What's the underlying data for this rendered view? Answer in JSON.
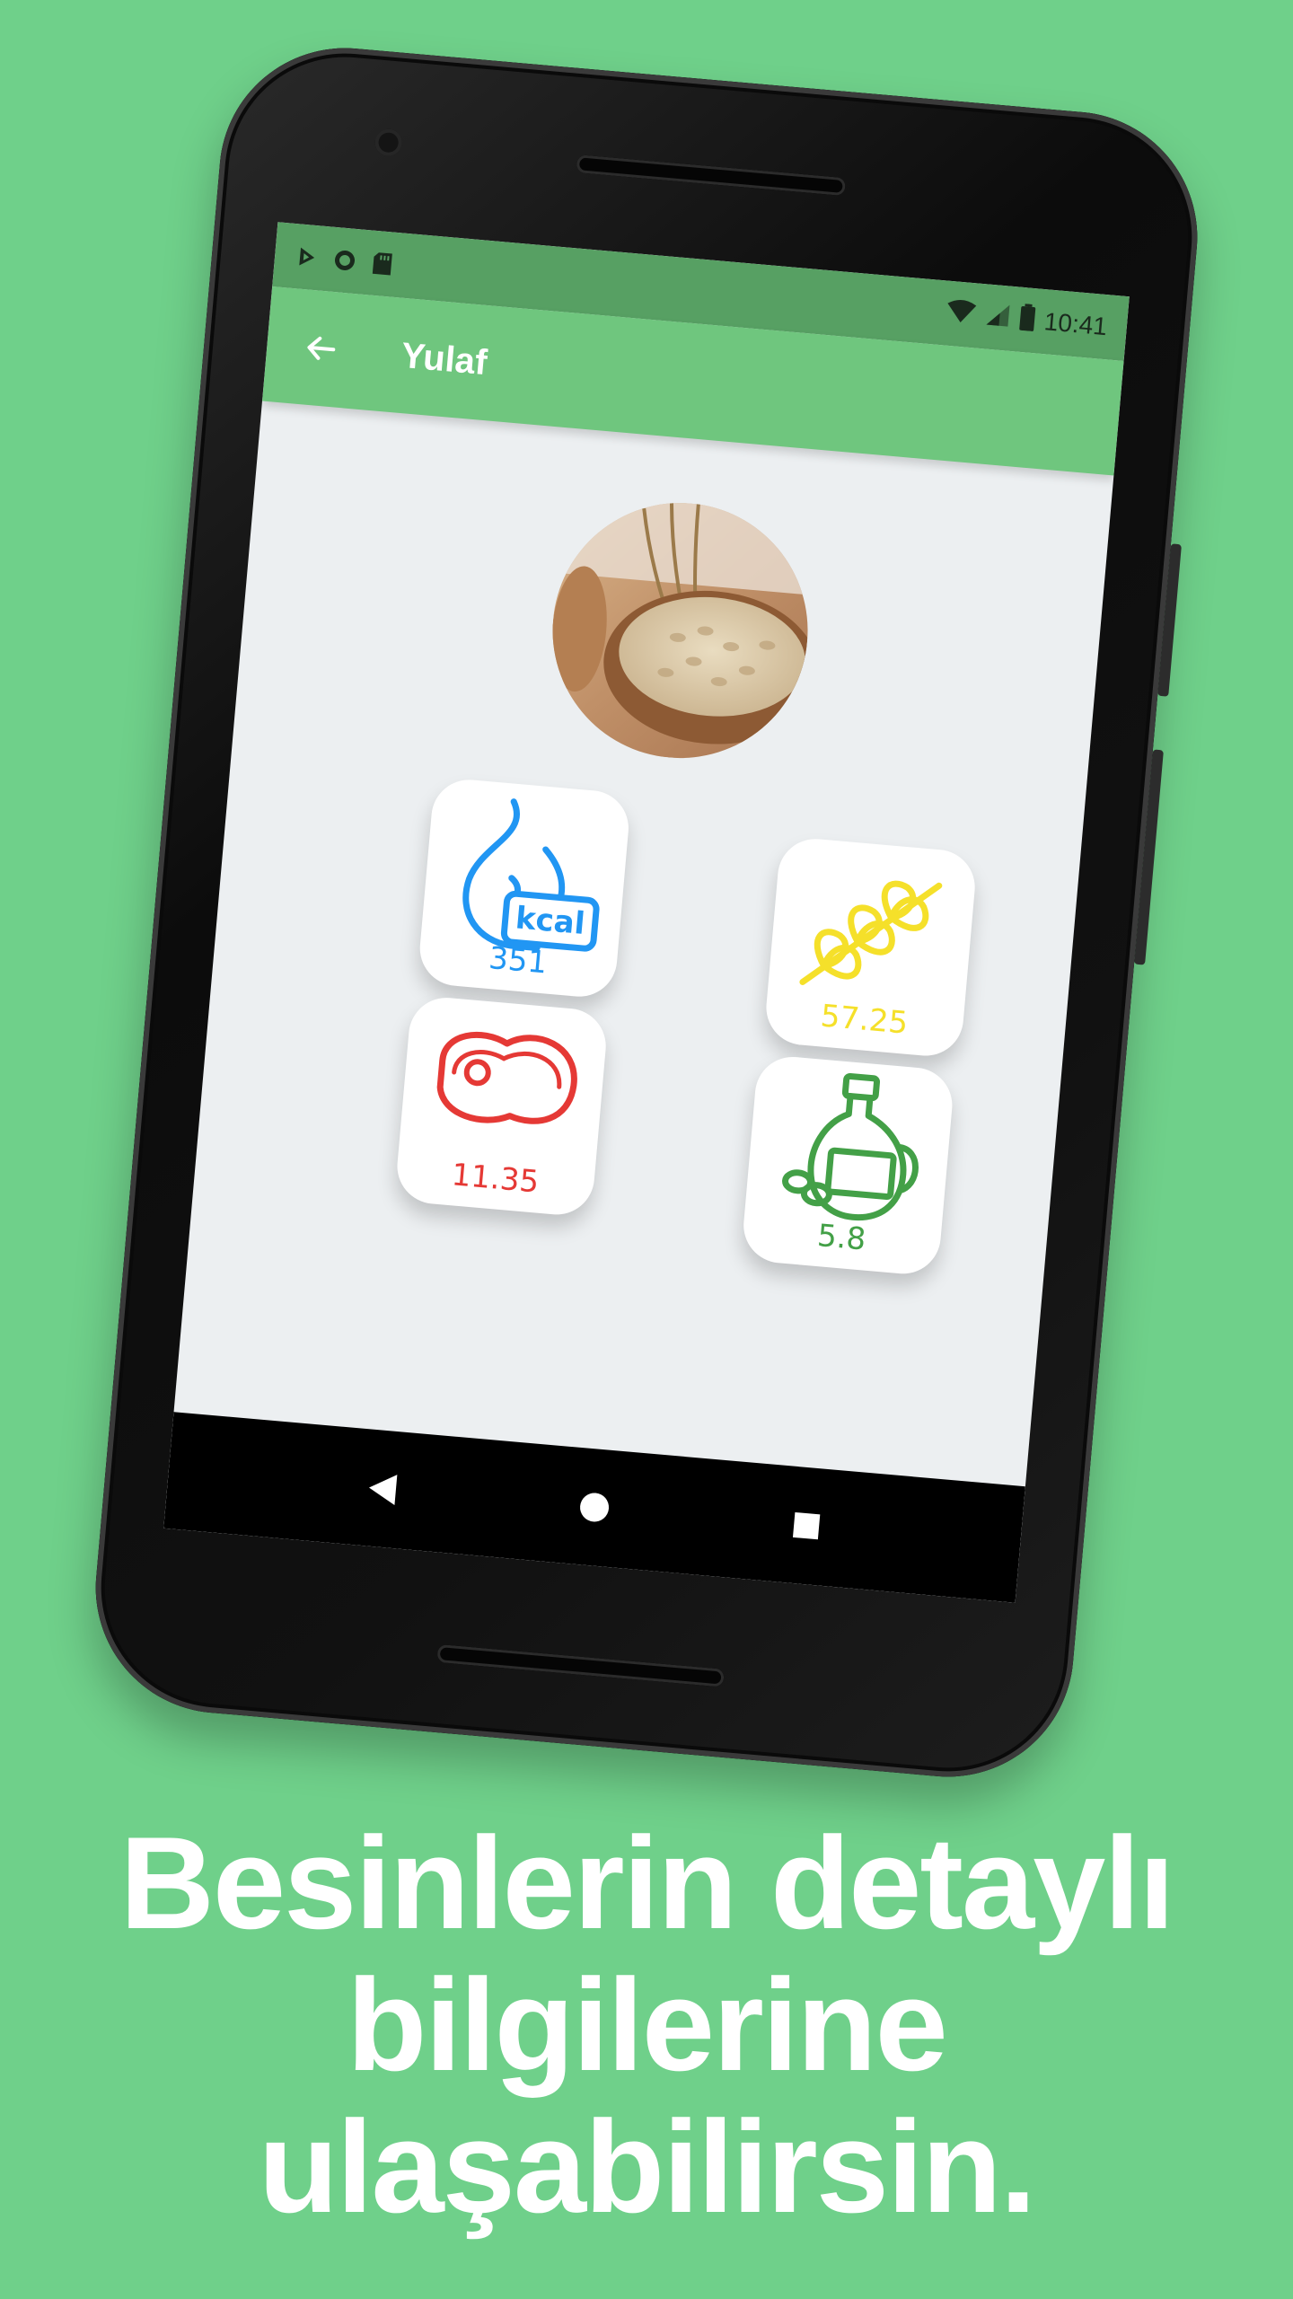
{
  "status_bar": {
    "time": "10:41"
  },
  "app_bar": {
    "title": "Yulaf",
    "back_icon": "arrow-left-icon"
  },
  "food": {
    "image_alt": "oats-bowl-photo"
  },
  "nutrients": [
    {
      "key": "calories",
      "icon": "kcal-flame-icon",
      "value": "351",
      "color": "#2196F3"
    },
    {
      "key": "carbohydrate",
      "icon": "wheat-icon",
      "value": "57.25",
      "color": "#F5E02A"
    },
    {
      "key": "protein",
      "icon": "meat-icon",
      "value": "11.35",
      "color": "#E53935"
    },
    {
      "key": "fat",
      "icon": "oil-bottle-icon",
      "value": "5.8",
      "color": "#43A047"
    }
  ],
  "caption": {
    "line1": "Besinlerin detaylı",
    "line2": "bilgilerine",
    "line3": "ulaşabilirsin."
  },
  "colors": {
    "background": "#6FD08A",
    "appbar": "#6FC67E",
    "statusbar": "#57A063",
    "screen": "#ECEFF1"
  }
}
